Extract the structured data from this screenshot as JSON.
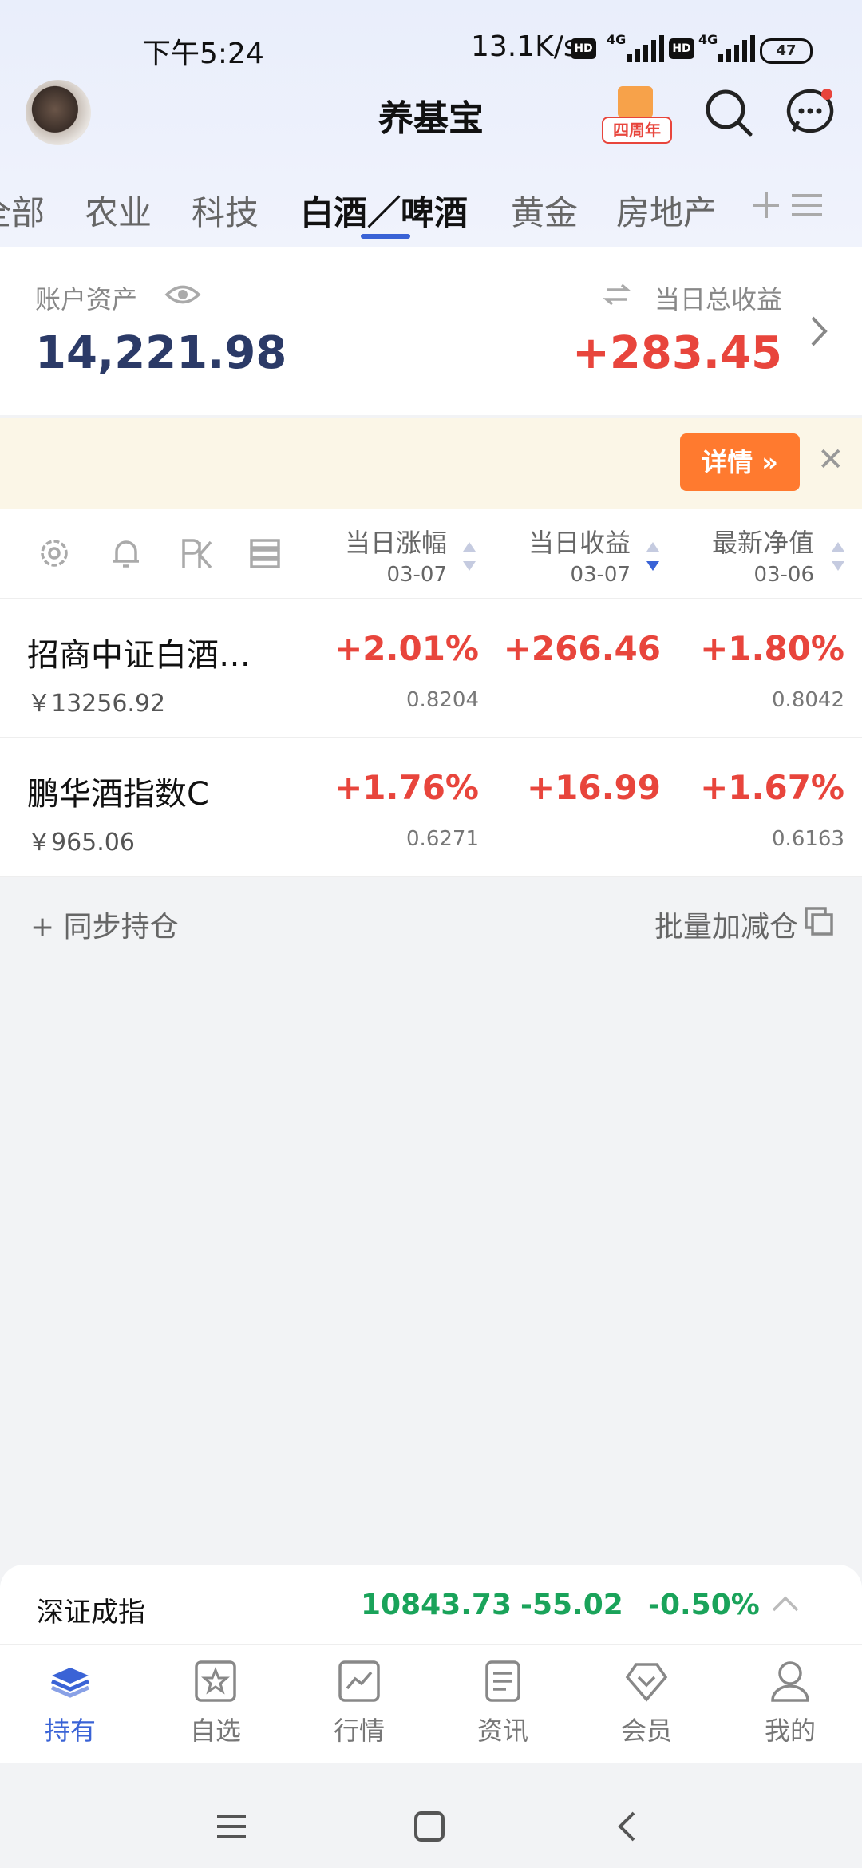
{
  "status_bar": {
    "time": "下午5:24",
    "network_speed": "13.1K/s",
    "battery": "47",
    "hd1": "HD",
    "g1": "4G",
    "hd2": "HD",
    "g2": "4G"
  },
  "header": {
    "title": "养基宝",
    "gift_label": "四周年"
  },
  "tabs": [
    {
      "label": "全部"
    },
    {
      "label": "农业"
    },
    {
      "label": "科技"
    },
    {
      "label": "白酒／啤酒",
      "active": true
    },
    {
      "label": "黄金"
    },
    {
      "label": "房地产"
    }
  ],
  "account": {
    "assets_label": "账户资产",
    "assets_value": "14,221.98",
    "today_label": "当日总收益",
    "today_value": "+283.45"
  },
  "banner": {
    "detail_button": "详情"
  },
  "table_header": {
    "col1": {
      "name": "当日涨幅",
      "date": "03-07"
    },
    "col2": {
      "name": "当日收益",
      "date": "03-07"
    },
    "col3": {
      "name": "最新净值",
      "date": "03-06"
    }
  },
  "funds": [
    {
      "name": "招商中证白酒…",
      "amount": "￥13256.92",
      "change": "+2.01%",
      "change_sub": "0.8204",
      "profit": "+266.46",
      "nav": "+1.80%",
      "nav_sub": "0.8042"
    },
    {
      "name": "鹏华酒指数C",
      "amount": "￥965.06",
      "change": "+1.76%",
      "change_sub": "0.6271",
      "profit": "+16.99",
      "nav": "+1.67%",
      "nav_sub": "0.6163"
    }
  ],
  "actions": {
    "sync": "+ 同步持仓",
    "batch": "批量加减仓"
  },
  "index": {
    "name": "深证成指",
    "value": "10843.73",
    "change": "-55.02",
    "percent": "-0.50%"
  },
  "bottom_nav": [
    {
      "label": "持有",
      "icon": "layers-icon",
      "active": true
    },
    {
      "label": "自选",
      "icon": "star-icon"
    },
    {
      "label": "行情",
      "icon": "chart-icon"
    },
    {
      "label": "资讯",
      "icon": "news-icon"
    },
    {
      "label": "会员",
      "icon": "diamond-icon"
    },
    {
      "label": "我的",
      "icon": "user-icon"
    }
  ],
  "colors": {
    "accent": "#3a63d6",
    "rise": "#e8453c",
    "fall": "#1aa35a",
    "detail": "#ff7a2f"
  }
}
